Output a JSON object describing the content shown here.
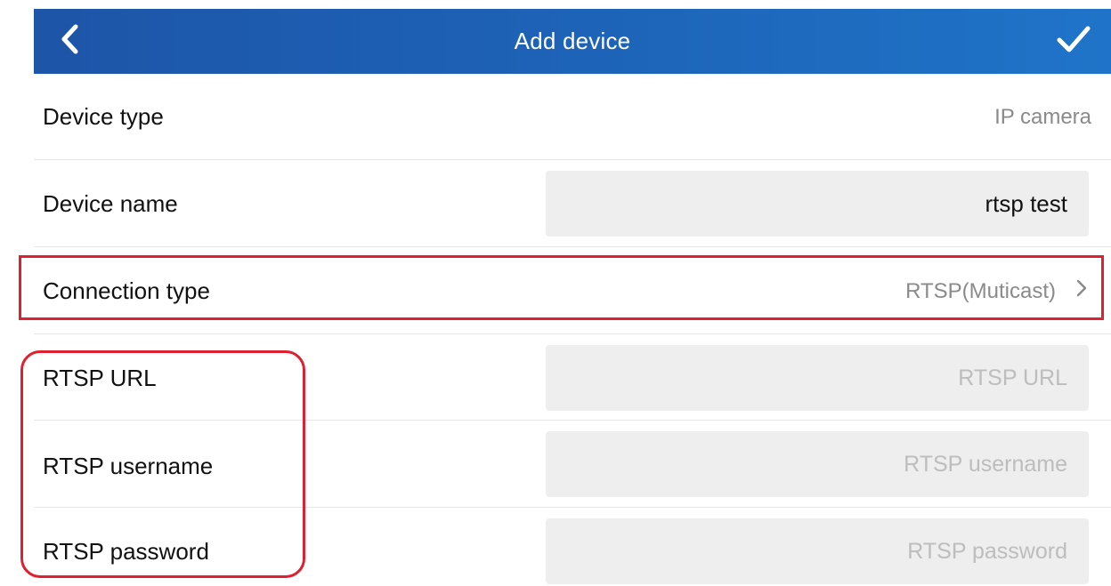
{
  "header": {
    "title": "Add device",
    "back_icon": "chevron-left-icon",
    "confirm_icon": "checkmark-icon",
    "color_start": "#1d55a8",
    "color_end": "#1f74c9"
  },
  "rows": {
    "device_type": {
      "label": "Device type",
      "value": "IP camera"
    },
    "device_name": {
      "label": "Device name",
      "value": "rtsp test"
    },
    "connection_type": {
      "label": "Connection type",
      "value": "RTSP(Muticast)",
      "icon": "chevron-right-icon"
    },
    "rtsp_url": {
      "label": "RTSP URL",
      "value": "",
      "placeholder": "RTSP URL"
    },
    "rtsp_username": {
      "label": "RTSP username",
      "value": "",
      "placeholder": "RTSP username"
    },
    "rtsp_password": {
      "label": "RTSP password",
      "value": "",
      "placeholder": "RTSP password"
    }
  },
  "annotations": {
    "highlight_color": "#e02030"
  }
}
